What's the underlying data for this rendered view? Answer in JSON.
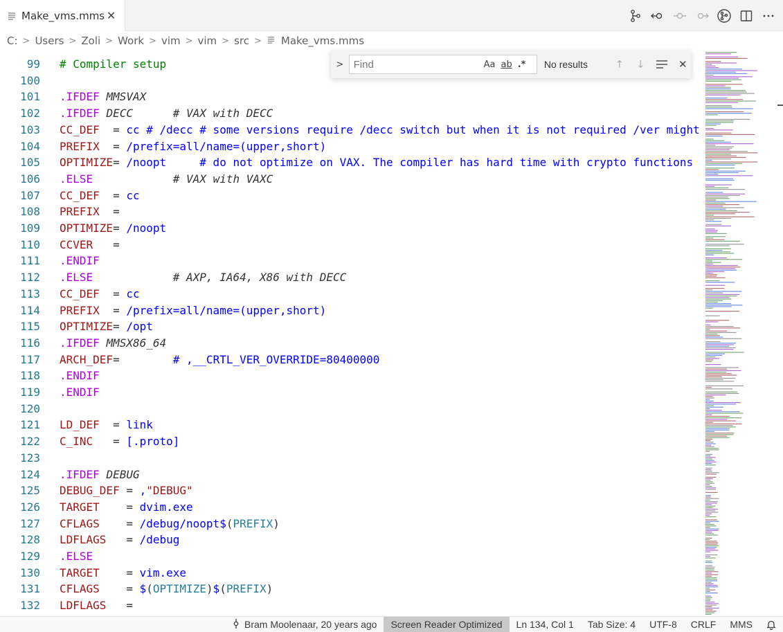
{
  "tab": {
    "label": "Make_vms.mms",
    "close": "✕"
  },
  "breadcrumb": [
    "C:",
    "Users",
    "Zoli",
    "Work",
    "vim",
    "vim",
    "src",
    "Make_vms.mms"
  ],
  "find": {
    "placeholder": "Find",
    "match_case": "Aa",
    "whole_word": "ab",
    "regex": ".*",
    "results": "No results"
  },
  "lines": [
    {
      "n": "99",
      "t": [
        [
          "cm",
          "# Compiler setup"
        ]
      ]
    },
    {
      "n": "100",
      "t": []
    },
    {
      "n": "101",
      "t": [
        [
          "kw",
          ".IFDEF "
        ],
        [
          "it",
          "MMSVAX"
        ]
      ]
    },
    {
      "n": "102",
      "t": [
        [
          "kw",
          ".IFDEF "
        ],
        [
          "it",
          "DECC      # VAX with DECC"
        ]
      ]
    },
    {
      "n": "103",
      "t": [
        [
          "vr",
          "CC_DEF"
        ],
        [
          "tx",
          "  = "
        ],
        [
          "vl",
          "cc # /decc # some versions require /decc switch but when it is not required /ver might"
        ]
      ]
    },
    {
      "n": "104",
      "t": [
        [
          "vr",
          "PREFIX"
        ],
        [
          "tx",
          "  = "
        ],
        [
          "vl",
          "/prefix=all/name=(upper,short)"
        ]
      ]
    },
    {
      "n": "105",
      "t": [
        [
          "vr",
          "OPTIMIZE"
        ],
        [
          "tx",
          "= "
        ],
        [
          "vl",
          "/noopt     # do not optimize on VAX. The compiler has hard time with crypto functions"
        ]
      ]
    },
    {
      "n": "106",
      "t": [
        [
          "kw",
          ".ELSE"
        ],
        [
          "it",
          "            # VAX with VAXC"
        ]
      ]
    },
    {
      "n": "107",
      "t": [
        [
          "vr",
          "CC_DEF"
        ],
        [
          "tx",
          "  = "
        ],
        [
          "vl",
          "cc"
        ]
      ]
    },
    {
      "n": "108",
      "t": [
        [
          "vr",
          "PREFIX"
        ],
        [
          "tx",
          "  ="
        ]
      ]
    },
    {
      "n": "109",
      "t": [
        [
          "vr",
          "OPTIMIZE"
        ],
        [
          "tx",
          "= "
        ],
        [
          "vl",
          "/noopt"
        ]
      ]
    },
    {
      "n": "110",
      "t": [
        [
          "vr",
          "CCVER"
        ],
        [
          "tx",
          "   ="
        ]
      ]
    },
    {
      "n": "111",
      "t": [
        [
          "kw",
          ".ENDIF"
        ]
      ]
    },
    {
      "n": "112",
      "t": [
        [
          "kw",
          ".ELSE"
        ],
        [
          "it",
          "            # AXP, IA64, X86 with DECC"
        ]
      ]
    },
    {
      "n": "113",
      "t": [
        [
          "vr",
          "CC_DEF"
        ],
        [
          "tx",
          "  = "
        ],
        [
          "vl",
          "cc"
        ]
      ]
    },
    {
      "n": "114",
      "t": [
        [
          "vr",
          "PREFIX"
        ],
        [
          "tx",
          "  = "
        ],
        [
          "vl",
          "/prefix=all/name=(upper,short)"
        ]
      ]
    },
    {
      "n": "115",
      "t": [
        [
          "vr",
          "OPTIMIZE"
        ],
        [
          "tx",
          "= "
        ],
        [
          "vl",
          "/opt"
        ]
      ]
    },
    {
      "n": "116",
      "t": [
        [
          "kw",
          ".IFDEF "
        ],
        [
          "it",
          "MMSX86_64"
        ]
      ]
    },
    {
      "n": "117",
      "t": [
        [
          "vr",
          "ARCH_DEF"
        ],
        [
          "tx",
          "=        "
        ],
        [
          "vl",
          "# ,__CRTL_VER_OVERRIDE=80400000"
        ]
      ]
    },
    {
      "n": "118",
      "t": [
        [
          "kw",
          ".ENDIF"
        ]
      ]
    },
    {
      "n": "119",
      "t": [
        [
          "kw",
          ".ENDIF"
        ]
      ]
    },
    {
      "n": "120",
      "t": []
    },
    {
      "n": "121",
      "t": [
        [
          "vr",
          "LD_DEF"
        ],
        [
          "tx",
          "  = "
        ],
        [
          "vl",
          "link"
        ]
      ]
    },
    {
      "n": "122",
      "t": [
        [
          "vr",
          "C_INC"
        ],
        [
          "tx",
          "   = "
        ],
        [
          "vl",
          "[.proto]"
        ]
      ]
    },
    {
      "n": "123",
      "t": []
    },
    {
      "n": "124",
      "t": [
        [
          "kw",
          ".IFDEF "
        ],
        [
          "it",
          "DEBUG"
        ]
      ]
    },
    {
      "n": "125",
      "t": [
        [
          "vr",
          "DEBUG_DEF"
        ],
        [
          "tx",
          " = "
        ],
        [
          "vl",
          ","
        ],
        [
          "str",
          "\"DEBUG\""
        ]
      ]
    },
    {
      "n": "126",
      "t": [
        [
          "vr",
          "TARGET"
        ],
        [
          "tx",
          "    = "
        ],
        [
          "vl",
          "dvim.exe"
        ]
      ]
    },
    {
      "n": "127",
      "t": [
        [
          "vr",
          "CFLAGS"
        ],
        [
          "tx",
          "    = "
        ],
        [
          "vl",
          "/debug/noopt$"
        ],
        [
          "tx",
          "("
        ],
        [
          "fn",
          "PREFIX"
        ],
        [
          "tx",
          ")"
        ]
      ]
    },
    {
      "n": "128",
      "t": [
        [
          "vr",
          "LDFLAGS"
        ],
        [
          "tx",
          "   = "
        ],
        [
          "vl",
          "/debug"
        ]
      ]
    },
    {
      "n": "129",
      "t": [
        [
          "kw",
          ".ELSE"
        ]
      ]
    },
    {
      "n": "130",
      "t": [
        [
          "vr",
          "TARGET"
        ],
        [
          "tx",
          "    = "
        ],
        [
          "vl",
          "vim.exe"
        ]
      ]
    },
    {
      "n": "131",
      "t": [
        [
          "vr",
          "CFLAGS"
        ],
        [
          "tx",
          "    = "
        ],
        [
          "vl",
          "$"
        ],
        [
          "tx",
          "("
        ],
        [
          "fn",
          "OPTIMIZE"
        ],
        [
          "tx",
          ")"
        ],
        [
          "vl",
          "$"
        ],
        [
          "tx",
          "("
        ],
        [
          "fn",
          "PREFIX"
        ],
        [
          "tx",
          ")"
        ]
      ]
    },
    {
      "n": "132",
      "t": [
        [
          "vr",
          "LDFLAGS"
        ],
        [
          "tx",
          "   ="
        ]
      ]
    }
  ],
  "status": {
    "blame": "Bram Moolenaar, 20 years ago",
    "screen_reader": "Screen Reader Optimized",
    "position": "Ln 134, Col 1",
    "tab_size": "Tab Size: 4",
    "encoding": "UTF-8",
    "eol": "CRLF",
    "language": "MMS"
  },
  "colors": {
    "comment": "#008000",
    "keyword": "#af00db",
    "variable": "#a31515",
    "value": "#0000ff",
    "function": "#267f99",
    "line_number": "#237893"
  }
}
